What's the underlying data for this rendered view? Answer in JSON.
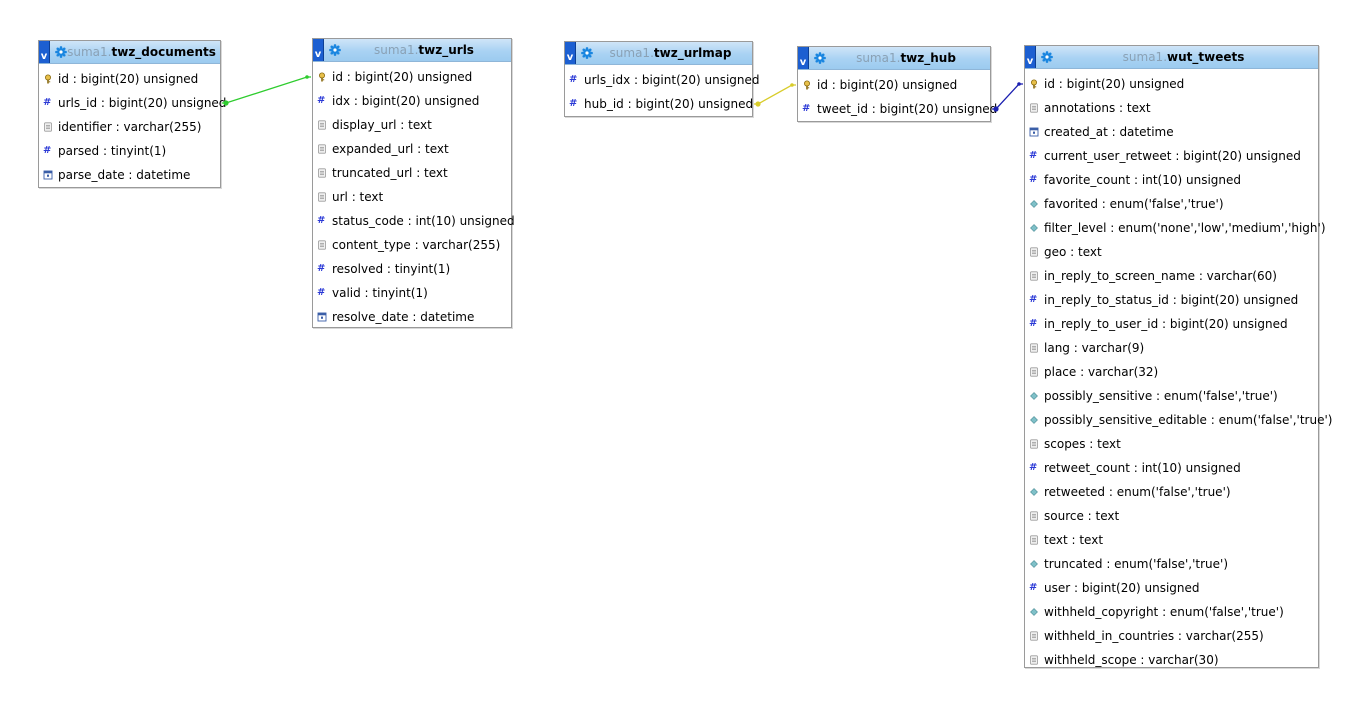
{
  "tables": [
    {
      "id": "twz_documents",
      "db": "suma1",
      "name": "twz_documents",
      "toggle_label": "v",
      "fields": [
        {
          "icon": "key-icon",
          "label": "id : bigint(20) unsigned"
        },
        {
          "icon": "numeric-icon",
          "label": "urls_id : bigint(20) unsigned"
        },
        {
          "icon": "text-icon",
          "label": "identifier : varchar(255)"
        },
        {
          "icon": "numeric-icon",
          "label": "parsed : tinyint(1)"
        },
        {
          "icon": "date-icon",
          "label": "parse_date : datetime"
        }
      ]
    },
    {
      "id": "twz_urls",
      "db": "suma1",
      "name": "twz_urls",
      "toggle_label": "v",
      "fields": [
        {
          "icon": "key-icon",
          "label": "id : bigint(20) unsigned"
        },
        {
          "icon": "numeric-icon",
          "label": "idx : bigint(20) unsigned"
        },
        {
          "icon": "text-icon",
          "label": "display_url : text"
        },
        {
          "icon": "text-icon",
          "label": "expanded_url : text"
        },
        {
          "icon": "text-icon",
          "label": "truncated_url : text"
        },
        {
          "icon": "text-icon",
          "label": "url : text"
        },
        {
          "icon": "numeric-icon",
          "label": "status_code : int(10) unsigned"
        },
        {
          "icon": "text-icon",
          "label": "content_type : varchar(255)"
        },
        {
          "icon": "numeric-icon",
          "label": "resolved : tinyint(1)"
        },
        {
          "icon": "numeric-icon",
          "label": "valid : tinyint(1)"
        },
        {
          "icon": "date-icon",
          "label": "resolve_date : datetime"
        }
      ]
    },
    {
      "id": "twz_urlmap",
      "db": "suma1",
      "name": "twz_urlmap",
      "toggle_label": "v",
      "fields": [
        {
          "icon": "numeric-icon",
          "label": "urls_idx : bigint(20) unsigned"
        },
        {
          "icon": "numeric-icon",
          "label": "hub_id : bigint(20) unsigned"
        }
      ]
    },
    {
      "id": "twz_hub",
      "db": "suma1",
      "name": "twz_hub",
      "toggle_label": "v",
      "fields": [
        {
          "icon": "key-icon",
          "label": "id : bigint(20) unsigned"
        },
        {
          "icon": "numeric-icon",
          "label": "tweet_id : bigint(20) unsigned"
        }
      ]
    },
    {
      "id": "wut_tweets",
      "db": "suma1",
      "name": "wut_tweets",
      "toggle_label": "v",
      "fields": [
        {
          "icon": "key-icon",
          "label": "id : bigint(20) unsigned"
        },
        {
          "icon": "text-icon",
          "label": "annotations : text"
        },
        {
          "icon": "date-icon",
          "label": "created_at : datetime"
        },
        {
          "icon": "numeric-icon",
          "label": "current_user_retweet : bigint(20) unsigned"
        },
        {
          "icon": "numeric-icon",
          "label": "favorite_count : int(10) unsigned"
        },
        {
          "icon": "enum-icon",
          "label": "favorited : enum('false','true')"
        },
        {
          "icon": "enum-icon",
          "label": "filter_level : enum('none','low','medium','high')"
        },
        {
          "icon": "text-icon",
          "label": "geo : text"
        },
        {
          "icon": "text-icon",
          "label": "in_reply_to_screen_name : varchar(60)"
        },
        {
          "icon": "numeric-icon",
          "label": "in_reply_to_status_id : bigint(20) unsigned"
        },
        {
          "icon": "numeric-icon",
          "label": "in_reply_to_user_id : bigint(20) unsigned"
        },
        {
          "icon": "text-icon",
          "label": "lang : varchar(9)"
        },
        {
          "icon": "text-icon",
          "label": "place : varchar(32)"
        },
        {
          "icon": "enum-icon",
          "label": "possibly_sensitive : enum('false','true')"
        },
        {
          "icon": "enum-icon",
          "label": "possibly_sensitive_editable : enum('false','true')"
        },
        {
          "icon": "text-icon",
          "label": "scopes : text"
        },
        {
          "icon": "numeric-icon",
          "label": "retweet_count : int(10) unsigned"
        },
        {
          "icon": "enum-icon",
          "label": "retweeted : enum('false','true')"
        },
        {
          "icon": "text-icon",
          "label": "source : text"
        },
        {
          "icon": "text-icon",
          "label": "text : text"
        },
        {
          "icon": "enum-icon",
          "label": "truncated : enum('false','true')"
        },
        {
          "icon": "numeric-icon",
          "label": "user : bigint(20) unsigned"
        },
        {
          "icon": "enum-icon",
          "label": "withheld_copyright : enum('false','true')"
        },
        {
          "icon": "text-icon",
          "label": "withheld_in_countries : varchar(255)"
        },
        {
          "icon": "text-icon",
          "label": "withheld_scope : varchar(30)"
        }
      ]
    }
  ],
  "relations": [
    {
      "from_table": "twz_documents",
      "from_field": "urls_id : bigint(20) unsigned",
      "to_table": "twz_urls",
      "to_field": "id : bigint(20) unsigned",
      "color": "#2ecc2e"
    },
    {
      "from_table": "twz_urlmap",
      "from_field": "hub_id : bigint(20) unsigned",
      "to_table": "twz_hub",
      "to_field": "id : bigint(20) unsigned",
      "color": "#d8cc2a"
    },
    {
      "from_table": "twz_hub",
      "from_field": "tweet_id : bigint(20) unsigned",
      "to_table": "wut_tweets",
      "to_field": "id : bigint(20) unsigned",
      "color": "#1a1fb0"
    }
  ],
  "colors": {
    "header_top": "#cfe5f8",
    "header_bottom": "#9ccbef",
    "toggle": "#1c5fd1",
    "db_prefix": "#8aa1b5",
    "hash": "#2c3ad6"
  }
}
